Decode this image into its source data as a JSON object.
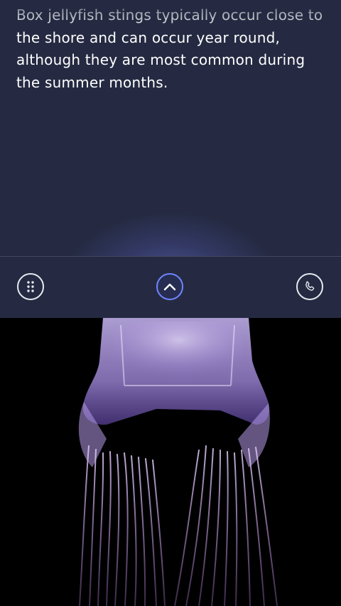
{
  "article": {
    "text": "Box jellyfish stings typically occur close to the shore and can occur year round, although they are most common during the summer months."
  },
  "toolbar": {
    "menu_icon": "dots-grid-icon",
    "expand_icon": "chevron-up-icon",
    "call_icon": "phone-icon"
  },
  "image": {
    "subject": "box jellyfish photo"
  },
  "colors": {
    "panel_bg": "#252a42",
    "accent": "#6f86ff",
    "divider": "#434862",
    "photo_bg": "#000000"
  }
}
